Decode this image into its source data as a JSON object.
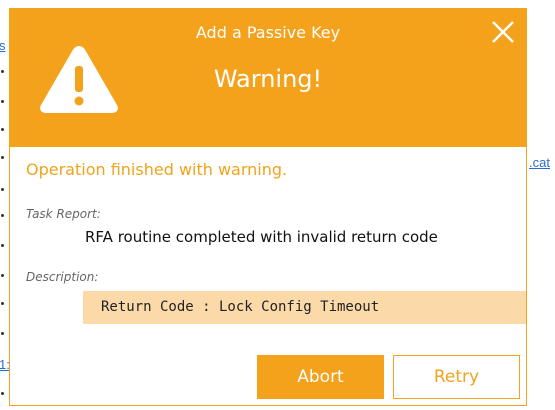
{
  "background": {
    "link_left_top": "s",
    "link_left_bottom": "1:",
    "link_right": ".cat"
  },
  "dialog": {
    "title": "Add a Passive Key",
    "heading": "Warning!",
    "status_message": "Operation finished with warning.",
    "task_report_label": "Task Report:",
    "task_report_text": "RFA routine completed with invalid return code",
    "description_label": "Description:",
    "description_text": "Return Code : Lock Config Timeout",
    "buttons": {
      "abort": "Abort",
      "retry": "Retry"
    },
    "icons": {
      "close": "close-icon",
      "warning": "warning-icon"
    }
  },
  "colors": {
    "accent": "#f4a11c",
    "code_background": "#fbd9a8",
    "link": "#2a6bd1"
  }
}
